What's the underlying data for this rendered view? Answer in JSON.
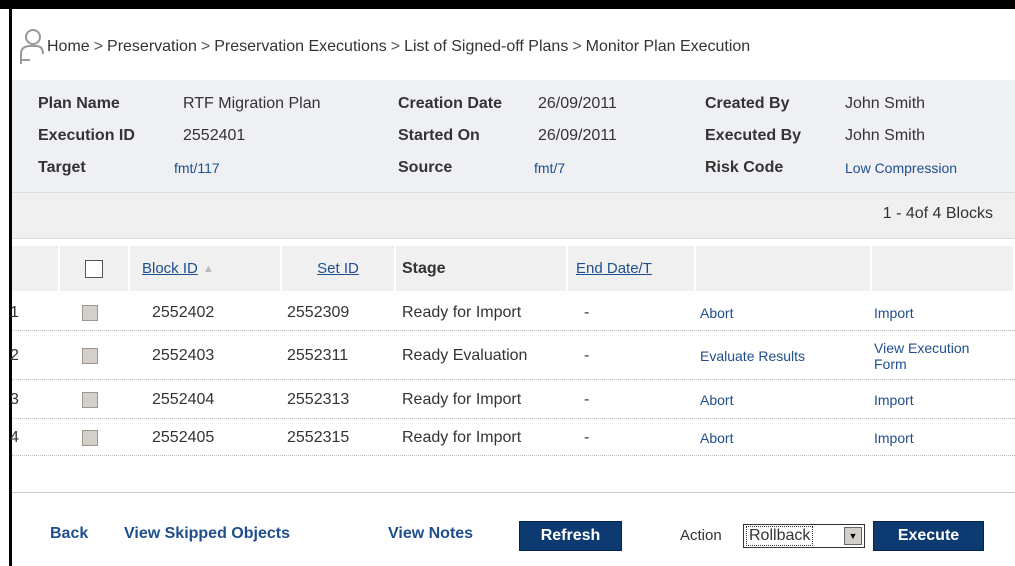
{
  "breadcrumb": [
    "Home",
    "Preservation",
    "Preservation Executions",
    "List of Signed-off Plans",
    "Monitor Plan Execution"
  ],
  "breadcrumb_separator": ">",
  "info": {
    "plan_name_label": "Plan Name",
    "plan_name": "RTF Migration Plan",
    "creation_date_label": "Creation Date",
    "creation_date": "26/09/2011",
    "created_by_label": "Created By",
    "created_by": "John Smith",
    "execution_id_label": "Execution ID",
    "execution_id": "2552401",
    "started_on_label": "Started On",
    "started_on": "26/09/2011",
    "executed_by_label": "Executed By",
    "executed_by": "John Smith",
    "target_label": "Target",
    "target": "fmt/117",
    "source_label": "Source",
    "source": "fmt/7",
    "risk_code_label": "Risk Code",
    "risk_code": "Low Compression"
  },
  "paging": "1 - 4of 4 Blocks",
  "table": {
    "headers": {
      "block_id": "Block ID",
      "set_id": "Set ID",
      "stage": "Stage",
      "end_date": "End Date/T"
    },
    "rows": [
      {
        "num": "1",
        "block_id": "2552402",
        "set_id": "2552309",
        "stage": "Ready for Import",
        "end": "-",
        "action1": "Abort",
        "action2": "Import"
      },
      {
        "num": "2",
        "block_id": "2552403",
        "set_id": "2552311",
        "stage": "Ready Evaluation",
        "end": "-",
        "action1": "Evaluate Results",
        "action2_line1": "View Execution",
        "action2_line2": "Form"
      },
      {
        "num": "3",
        "block_id": "2552404",
        "set_id": "2552313",
        "stage": "Ready for Import",
        "end": "-",
        "action1": "Abort",
        "action2": "Import"
      },
      {
        "num": "4",
        "block_id": "2552405",
        "set_id": "2552315",
        "stage": "Ready for Import",
        "end": "-",
        "action1": "Abort",
        "action2": "Import"
      }
    ]
  },
  "bottom": {
    "back": "Back",
    "view_skipped": "View Skipped Objects",
    "view_notes": "View Notes",
    "refresh": "Refresh",
    "action_label": "Action",
    "action_value": "Rollback",
    "execute": "Execute"
  },
  "colors": {
    "link": "#1f4e8c",
    "button": "#0e3a72",
    "panel": "#eef0f3"
  }
}
